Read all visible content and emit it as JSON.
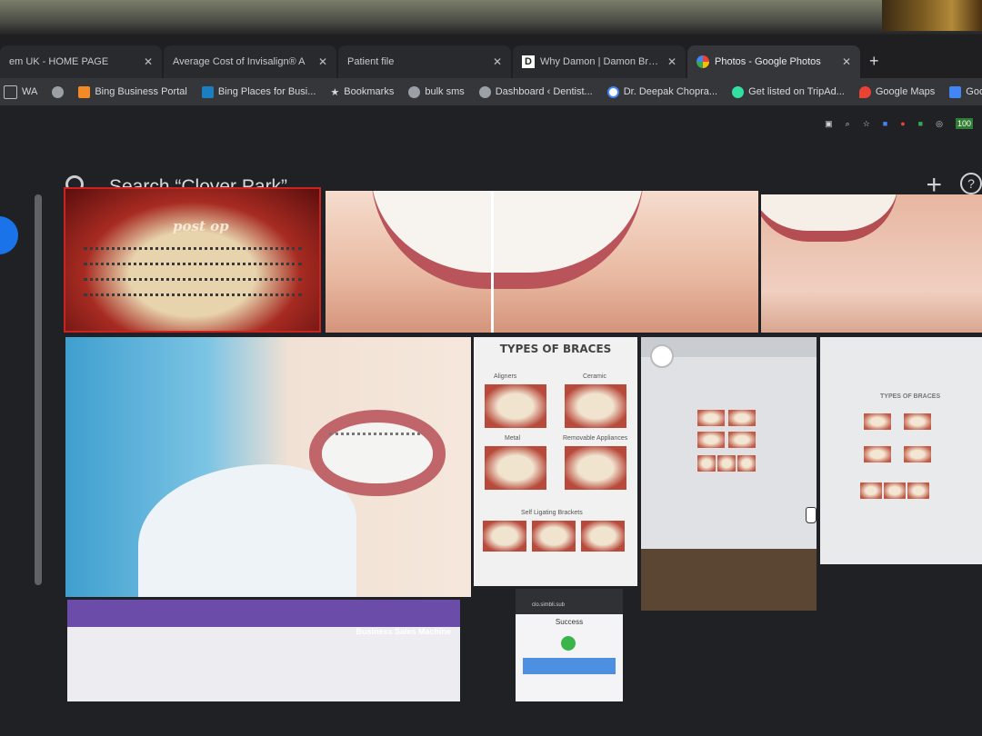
{
  "tabs": [
    {
      "label": "em UK - HOME PAGE",
      "favicon": "",
      "active": false
    },
    {
      "label": "Average Cost of Invisalign® A",
      "favicon": "",
      "active": false
    },
    {
      "label": "Patient file",
      "favicon": "",
      "active": false
    },
    {
      "label": "Why Damon | Damon Braces",
      "favicon": "D",
      "active": false
    },
    {
      "label": "Photos - Google Photos",
      "favicon": "pinwheel",
      "active": true
    }
  ],
  "bookmarks": [
    {
      "label": "WA",
      "icon": "folder-icon"
    },
    {
      "label": "",
      "icon": "globe-icon"
    },
    {
      "label": "Bing Business Portal",
      "icon": "bing-icon"
    },
    {
      "label": "Bing Places for Busi...",
      "icon": "bing-icon"
    },
    {
      "label": "Bookmarks",
      "icon": "star-icon"
    },
    {
      "label": "bulk sms",
      "icon": "globe-icon"
    },
    {
      "label": "Dashboard ‹ Dentist...",
      "icon": "globe-icon"
    },
    {
      "label": "Dr. Deepak Chopra...",
      "icon": "google-icon"
    },
    {
      "label": "Get listed on TripAd...",
      "icon": "tripadvisor-icon"
    },
    {
      "label": "Google Maps",
      "icon": "maps-icon"
    },
    {
      "label": "Google My Business",
      "icon": "gmb-icon"
    }
  ],
  "extension_badge": "100",
  "search": {
    "query": "Search “Clover Park”"
  },
  "photos": {
    "post_op_label": "post op",
    "types_title": "TYPES OF BRACES",
    "types_captions": [
      "Aligners",
      "Ceramic",
      "Metal",
      "Removable Appliances",
      "Self Ligating Brackets"
    ],
    "mini_title": "TYPES OF BRACES",
    "phone_url": "clo.simbli.sub",
    "phone_success": "Success",
    "purple_header": "Business Sales Machine"
  },
  "colors": {
    "accent": "#1a73e8",
    "tab_bg": "#292a2d",
    "active_tab_bg": "#35363a"
  }
}
